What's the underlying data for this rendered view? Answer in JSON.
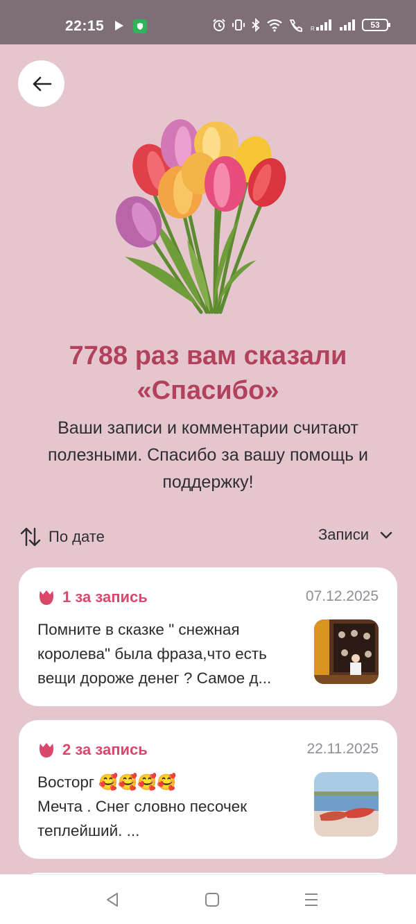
{
  "status_bar": {
    "time": "22:15",
    "battery": "53",
    "icons": [
      "play-icon",
      "shield-icon",
      "alarm-icon",
      "vibrate-icon",
      "bluetooth-icon",
      "wifi-icon",
      "call-icon",
      "signal-icon",
      "signal-icon",
      "battery-icon"
    ]
  },
  "header": {
    "back_icon": "arrow-left-icon",
    "headline": "7788 раз вам сказали «Спасибо»",
    "subtext": "Ваши записи и комментарии считают полезными. Спасибо за вашу помощь и поддержку!"
  },
  "sort": {
    "sort_label": "По дате",
    "sort_icon": "sort-arrows-icon",
    "filter_label": "Записи",
    "filter_icon": "chevron-down-icon"
  },
  "cards": [
    {
      "count_label": "1 за запись",
      "date": "07.12.2025",
      "lines": [
        "Помните в сказке \" снежная",
        "королева\" была фраза,что есть",
        "вещи дороже денег ? Самое д..."
      ],
      "thumb": "photo-icon"
    },
    {
      "count_label": "2 за запись",
      "date": "22.11.2025",
      "lines": [
        "Восторг 🥰🥰🥰🥰",
        "Мечта . Снег словно песочек",
        "теплейший. ..."
      ],
      "thumb": "photo-icon"
    }
  ],
  "colors": {
    "background": "#e5c6cf",
    "accent": "#b2425c",
    "tulip_icon": "#d9476b"
  },
  "navbar": {
    "icons": [
      "back-triangle-icon",
      "home-square-icon",
      "menu-lines-icon"
    ]
  }
}
